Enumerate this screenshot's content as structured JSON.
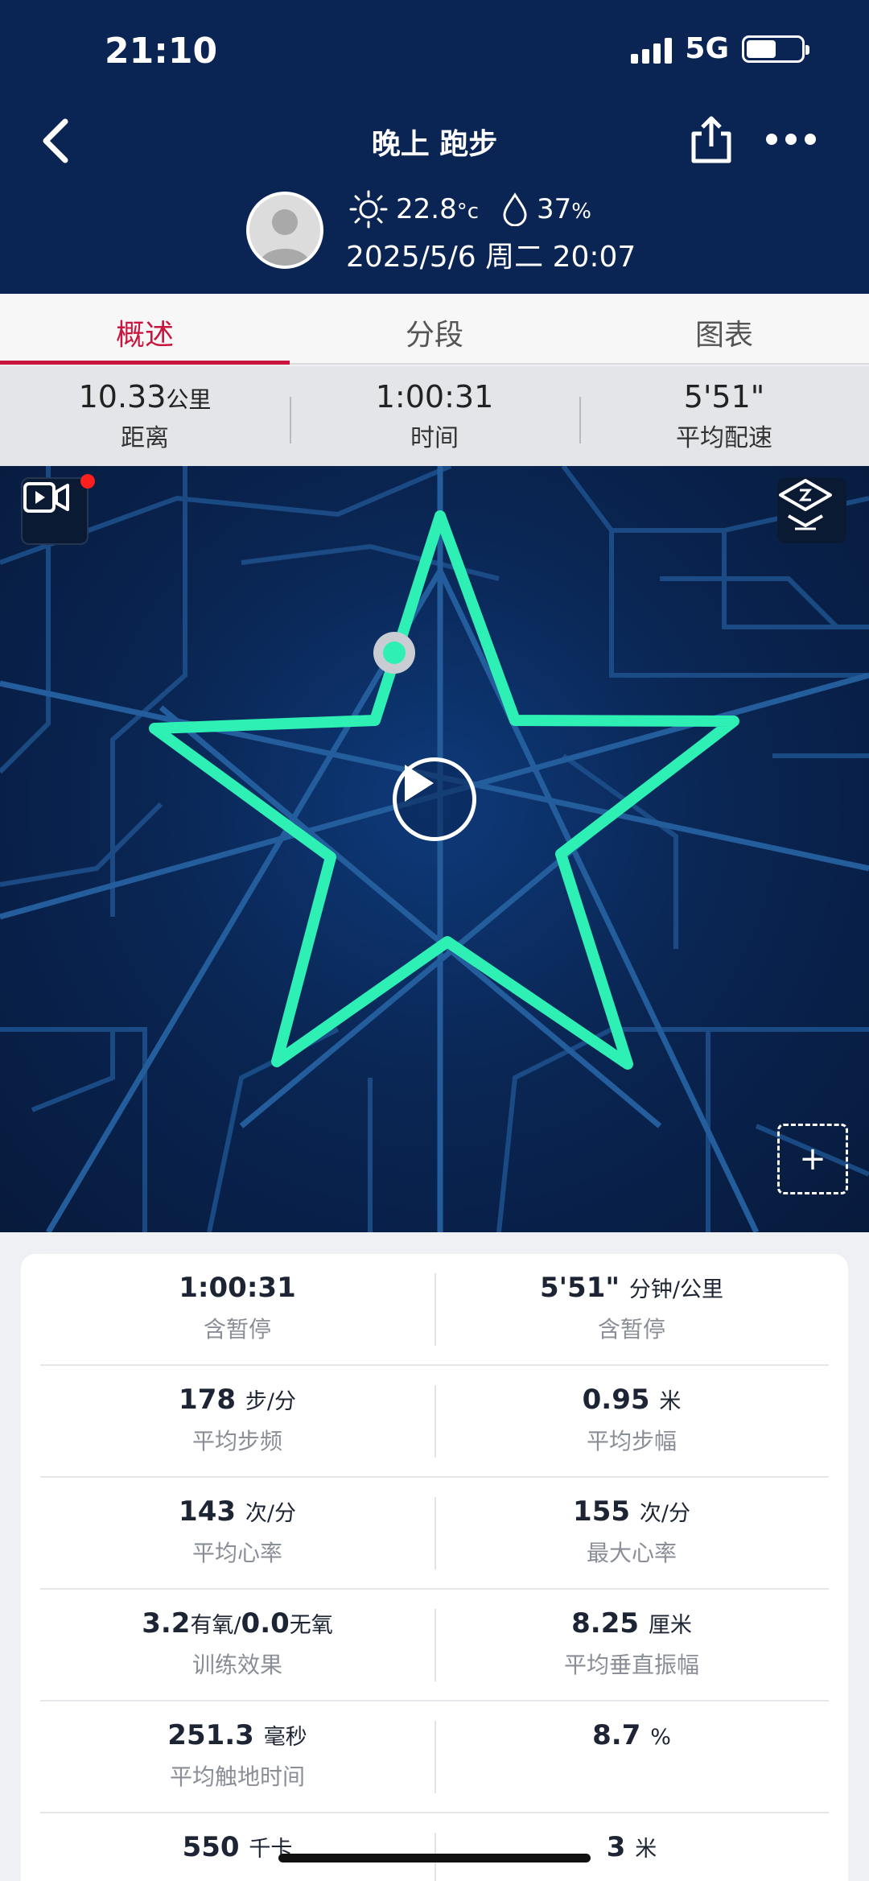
{
  "status": {
    "time": "21:10",
    "network": "5G"
  },
  "header": {
    "title": "晚上 跑步",
    "temperature": "22.8",
    "temp_unit": "°c",
    "humidity": "37",
    "humidity_unit": "%",
    "datetime": "2025/5/6 周二 20:07"
  },
  "tabs": [
    {
      "label": "概述"
    },
    {
      "label": "分段"
    },
    {
      "label": "图表"
    }
  ],
  "summary": [
    {
      "value": "10.33",
      "unit": "公里",
      "label": "距离"
    },
    {
      "value": "1:00:31",
      "unit": "",
      "label": "时间"
    },
    {
      "value": "5'51\"",
      "unit": "",
      "label": "平均配速"
    }
  ],
  "map": {
    "zoom_label": "+",
    "route_color": "#22e3a8"
  },
  "stats": [
    [
      {
        "value": "1:00:31",
        "unit": "",
        "label": "含暂停"
      },
      {
        "value": "5'51\"",
        "unit": "分钟/公里",
        "label": "含暂停"
      }
    ],
    [
      {
        "value": "178",
        "unit": "步/分",
        "label": "平均步频"
      },
      {
        "value": "0.95",
        "unit": "米",
        "label": "平均步幅"
      }
    ],
    [
      {
        "value": "143",
        "unit": "次/分",
        "label": "平均心率"
      },
      {
        "value": "155",
        "unit": "次/分",
        "label": "最大心率"
      }
    ],
    [
      {
        "value": "3.2",
        "unit": "有氧/",
        "value2": "0.0",
        "unit2": "无氧",
        "label": "训练效果"
      },
      {
        "value": "8.25",
        "unit": "厘米",
        "label": "平均垂直振幅"
      }
    ],
    [
      {
        "value": "251.3",
        "unit": "毫秒",
        "label": "平均触地时间"
      },
      {
        "value": "8.7",
        "unit": "%",
        "label": ""
      }
    ],
    [
      {
        "value": "550",
        "unit": "千卡",
        "label": ""
      },
      {
        "value": "3",
        "unit": "米",
        "label": ""
      }
    ]
  ]
}
